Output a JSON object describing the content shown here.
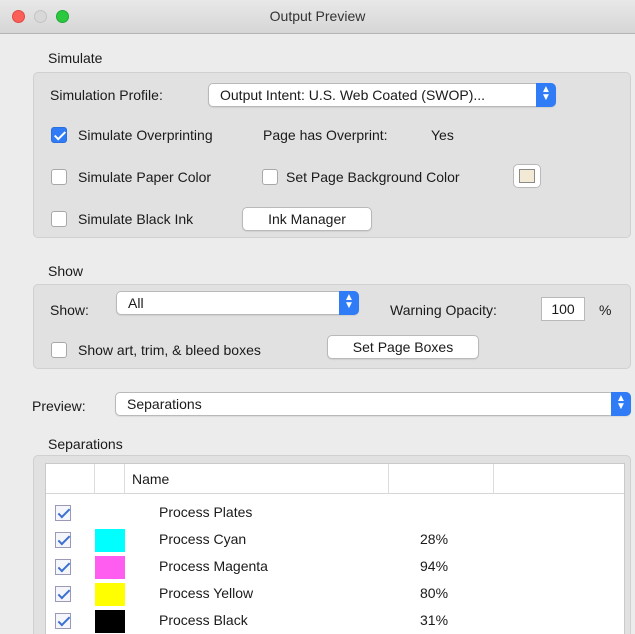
{
  "window": {
    "title": "Output Preview"
  },
  "simulate": {
    "section_label": "Simulate",
    "profile_label": "Simulation Profile:",
    "profile_value": "Output Intent: U.S. Web Coated (SWOP)...",
    "overprinting": {
      "label": "Simulate Overprinting",
      "checked": true
    },
    "overprint_status_label": "Page has Overprint:",
    "overprint_status_value": "Yes",
    "paper_color": {
      "label": "Simulate Paper Color",
      "checked": false
    },
    "page_bg_color": {
      "label": "Set Page Background Color",
      "checked": false,
      "swatch_color": "#f3ead6"
    },
    "black_ink": {
      "label": "Simulate Black Ink",
      "checked": false
    },
    "ink_manager_label": "Ink Manager"
  },
  "show": {
    "section_label": "Show",
    "show_label": "Show:",
    "show_value": "All",
    "warning_opacity_label": "Warning Opacity:",
    "warning_opacity_value": "100",
    "percent_symbol": "%",
    "boxes": {
      "label": "Show art, trim, & bleed boxes",
      "checked": false
    },
    "set_page_boxes_label": "Set Page Boxes"
  },
  "preview": {
    "label": "Preview:",
    "value": "Separations"
  },
  "separations": {
    "section_label": "Separations",
    "column_name": "Name",
    "rows": [
      {
        "name": "Process Plates",
        "value": "",
        "color": "",
        "checked": true
      },
      {
        "name": "Process Cyan",
        "value": "28%",
        "color": "#00ffff",
        "checked": true
      },
      {
        "name": "Process Magenta",
        "value": "94%",
        "color": "#ff5cf0",
        "checked": true
      },
      {
        "name": "Process Yellow",
        "value": "80%",
        "color": "#ffff00",
        "checked": true
      },
      {
        "name": "Process Black",
        "value": "31%",
        "color": "#000000",
        "checked": true
      }
    ]
  },
  "colors": {
    "accent": "#2f7cf6"
  }
}
